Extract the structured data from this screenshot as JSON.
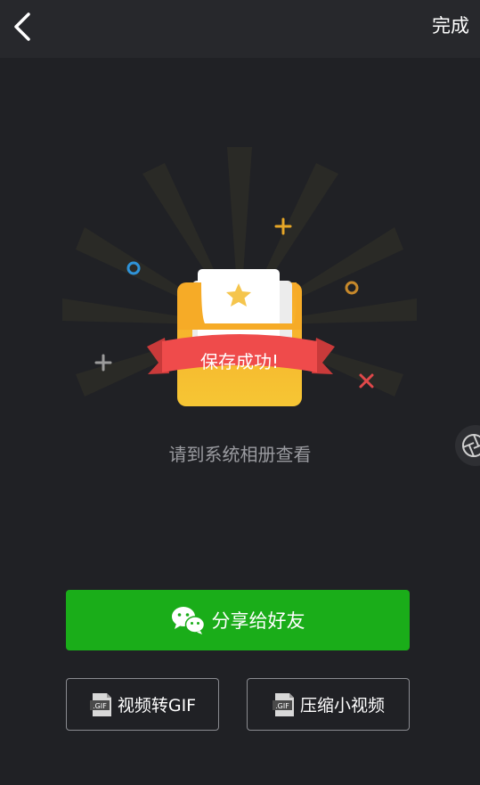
{
  "header": {
    "done_label": "完成"
  },
  "illustration": {
    "ribbon_text": "保存成功!"
  },
  "hint": "请到系统相册查看",
  "actions": {
    "share_label": "分享给好友",
    "gif_label": "视频转GIF",
    "compress_label": "压缩小视频",
    "gif_badge": ".GIF"
  },
  "colors": {
    "share_green": "#1aad19",
    "ribbon_red": "#ef4b4b",
    "card_yellow": "#f7b52c"
  },
  "icons": {
    "back": "chevron-left-icon",
    "share": "wechat-icon",
    "gif": "gif-file-icon",
    "side": "shutter-icon"
  }
}
